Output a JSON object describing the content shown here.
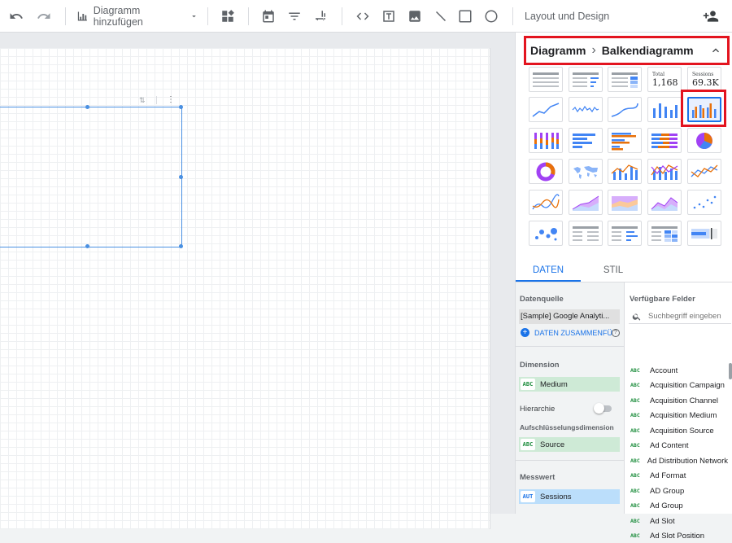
{
  "toolbar": {
    "add_chart_label": "Diagramm hinzufügen",
    "layout_label": "Layout und Design"
  },
  "panel": {
    "breadcrumb_root": "Diagramm",
    "breadcrumb_sep": "›",
    "breadcrumb_current": "Balkendiagramm",
    "thumb_total_label": "Total",
    "thumb_total_value": "1,168",
    "thumb_sessions_label": "Sessions",
    "thumb_sessions_value": "69.3K",
    "tabs": [
      "DATEN",
      "STIL"
    ]
  },
  "data": {
    "source_title": "Datenquelle",
    "source_value": "[Sample] Google Analyti...",
    "blend_label": "DATEN ZUSAMMENFÜ",
    "dimension_title": "Dimension",
    "dimension_tag": "ABC",
    "dimension_value": "Medium",
    "hierarchy_label": "Hierarchie",
    "breakdown_title": "Aufschlüsselungsdimension",
    "breakdown_tag": "ABC",
    "breakdown_value": "Source",
    "metric_title": "Messwert",
    "metric_tag": "AUT",
    "metric_value": "Sessions"
  },
  "fields": {
    "title": "Verfügbare Felder",
    "search_placeholder": "Suchbegriff eingeben",
    "tag": "ABC",
    "items": [
      "Account",
      "Acquisition Campaign",
      "Acquisition Channel",
      "Acquisition Medium",
      "Acquisition Source",
      "Ad Content",
      "Ad Distribution Network",
      "Ad Format",
      "AD Group",
      "Ad Group",
      "Ad Slot",
      "Ad Slot Position"
    ]
  },
  "colors": {
    "accent_blue": "#1a73e8",
    "highlight_red": "#e3141f",
    "dimension_green": "#ceead6",
    "metric_blue": "#bbdefb"
  }
}
